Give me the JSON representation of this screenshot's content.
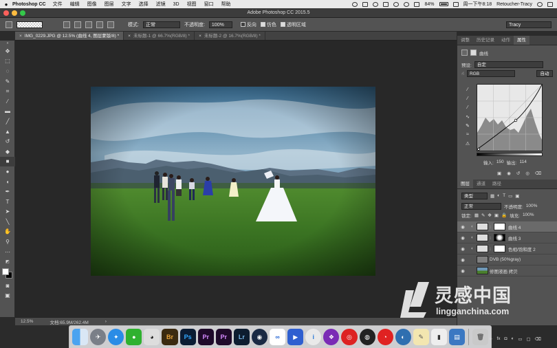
{
  "menubar": {
    "app_name": "Photoshop CC",
    "items": [
      "文件",
      "编辑",
      "图像",
      "图层",
      "文字",
      "选择",
      "滤镜",
      "3D",
      "视图",
      "窗口",
      "帮助"
    ],
    "battery": "84%",
    "datetime": "周一下午8:18",
    "user": "Retoucher-Tracy"
  },
  "window": {
    "title": "Adobe Photoshop CC 2015.5"
  },
  "options": {
    "mode_label": "模式:",
    "mode_value": "正常",
    "opacity_label": "不透明度:",
    "opacity_value": "100%",
    "reverse_label": "反向",
    "dither_label": "仿色",
    "transparency_label": "透明区域",
    "workspace": "Tracy"
  },
  "tabs": [
    {
      "label": "IMG_0229.JPG @ 12.5% (曲线 4, 图层蒙版/8) *"
    },
    {
      "label": "未标题-1 @ 66.7%(RGB/8) *"
    },
    {
      "label": "未标题-2 @ 16.7%(RGB/8) *"
    }
  ],
  "status": {
    "zoom": "12.5%",
    "doc": "文档:65.9M/262.4M"
  },
  "properties": {
    "tabs": [
      "调整",
      "历史记录",
      "动作",
      "属性"
    ],
    "title": "曲线",
    "preset_label": "预设:",
    "preset_value": "自定",
    "channel": "RGB",
    "auto_label": "自动",
    "input_label": "输入:",
    "input_value": "150",
    "output_label": "输出:",
    "output_value": "114"
  },
  "layers_panel": {
    "tabs": [
      "图层",
      "通道",
      "路径"
    ],
    "filter": "类型",
    "blend_mode": "正常",
    "opacity_label": "不透明度:",
    "opacity_value": "100%",
    "lock_label": "锁定:",
    "fill_label": "填充:",
    "fill_value": "100%",
    "layers": [
      {
        "name": "曲线 4"
      },
      {
        "name": "曲线 3"
      },
      {
        "name": "色相/饱和度 2"
      },
      {
        "name": "DVB (50%gray)"
      },
      {
        "name": "修图液画 拷贝"
      }
    ]
  },
  "watermark": {
    "title": "灵感中国",
    "url": "lingganchina.com"
  },
  "colors": {
    "accent": "#2d7cd6",
    "panel": "#535353",
    "canvas": "#282828"
  },
  "dock_apps": [
    "finder",
    "launchpad",
    "safari",
    "wechat",
    "qq",
    "bridge",
    "photoshop",
    "premiere",
    "premiere",
    "lightroom",
    "cinema4d",
    "baidu-netdisk",
    "video",
    "info",
    "davinci",
    "netease",
    "obs",
    "weibo",
    "browser",
    "notes",
    "charts",
    "keynote",
    "trash"
  ]
}
